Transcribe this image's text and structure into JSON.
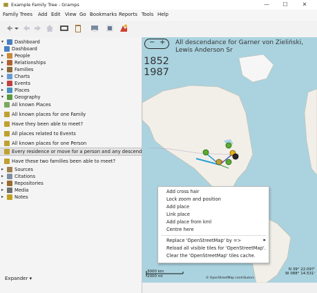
{
  "window": {
    "title": "Example Family Tree - Gramps",
    "minimize": "—",
    "maximize": "☐",
    "close": "✕"
  },
  "menu": [
    "Family Trees",
    "Add",
    "Edit",
    "View",
    "Go",
    "Bookmarks",
    "Reports",
    "Tools",
    "Help"
  ],
  "sidebar": {
    "items": [
      {
        "label": "Dashboard",
        "arrow": "▾",
        "icon_color": "#4a7fc1"
      },
      {
        "label": "Dashboard",
        "arrow": "",
        "icon_color": "#4a7fc1"
      },
      {
        "label": "People",
        "arrow": "▸",
        "icon_color": "#c98a3a"
      },
      {
        "label": "Relationships",
        "arrow": "▸",
        "icon_color": "#b06030"
      },
      {
        "label": "Families",
        "arrow": "▸",
        "icon_color": "#8a6a3a"
      },
      {
        "label": "Charts",
        "arrow": "▸",
        "icon_color": "#6a9ad0"
      },
      {
        "label": "Events",
        "arrow": "▸",
        "icon_color": "#c04040"
      },
      {
        "label": "Places",
        "arrow": "▸",
        "icon_color": "#4a90c0"
      },
      {
        "label": "Geography",
        "arrow": "▾",
        "icon_color": "#5a9a40"
      },
      {
        "label": "All known Places",
        "arrow": "",
        "icon_color": "#7aa860"
      },
      {
        "label": "All known places for one Family",
        "arrow": "",
        "icon_color": "#c0a030"
      },
      {
        "label": "Have they been able to meet?",
        "arrow": "",
        "icon_color": "#c0a030"
      },
      {
        "label": "All places related to Events",
        "arrow": "",
        "icon_color": "#c0a030"
      },
      {
        "label": "All known places for one Person",
        "arrow": "",
        "icon_color": "#c0a030"
      },
      {
        "label": "Every residence or move for a person and any descendants",
        "arrow": "",
        "icon_color": "#c0a030"
      },
      {
        "label": "Have these two families been able to meet?",
        "arrow": "",
        "icon_color": "#c0a030"
      },
      {
        "label": "Sources",
        "arrow": "▸",
        "icon_color": "#a08050"
      },
      {
        "label": "Citations",
        "arrow": "▸",
        "icon_color": "#8090a0"
      },
      {
        "label": "Repositories",
        "arrow": "▸",
        "icon_color": "#9a6a30"
      },
      {
        "label": "Media",
        "arrow": "▸",
        "icon_color": "#707070"
      },
      {
        "label": "Notes",
        "arrow": "▸",
        "icon_color": "#c0a020"
      }
    ],
    "expander": "Expander ▾"
  },
  "map": {
    "title": "All descendance for Garner von Zieliński, Lewis Anderson Sr",
    "year_start": "1852",
    "year_end": "1987",
    "zoom_minus": "−",
    "zoom_plus": "+",
    "scale_km": "3000 km",
    "scale_mi": "2000 mi",
    "credits": "© OpenStreetMap contributors",
    "lat": "N 39° 22.097'",
    "lon": "W 088° 14.531'",
    "water_color": "#aad3df",
    "land_color": "#f2efe9"
  },
  "context_menu": {
    "items": [
      "Add cross hair",
      "Lock zoom and position",
      "Add place",
      "Link place",
      "Add place from kml",
      "Centre here",
      "Replace 'OpenStreetMap' by =>",
      "Reload all visible tiles for 'OpenStreetMap'.",
      "Clear the 'OpenStreetMap' tiles cache."
    ],
    "submenu_arrow": "▸"
  }
}
